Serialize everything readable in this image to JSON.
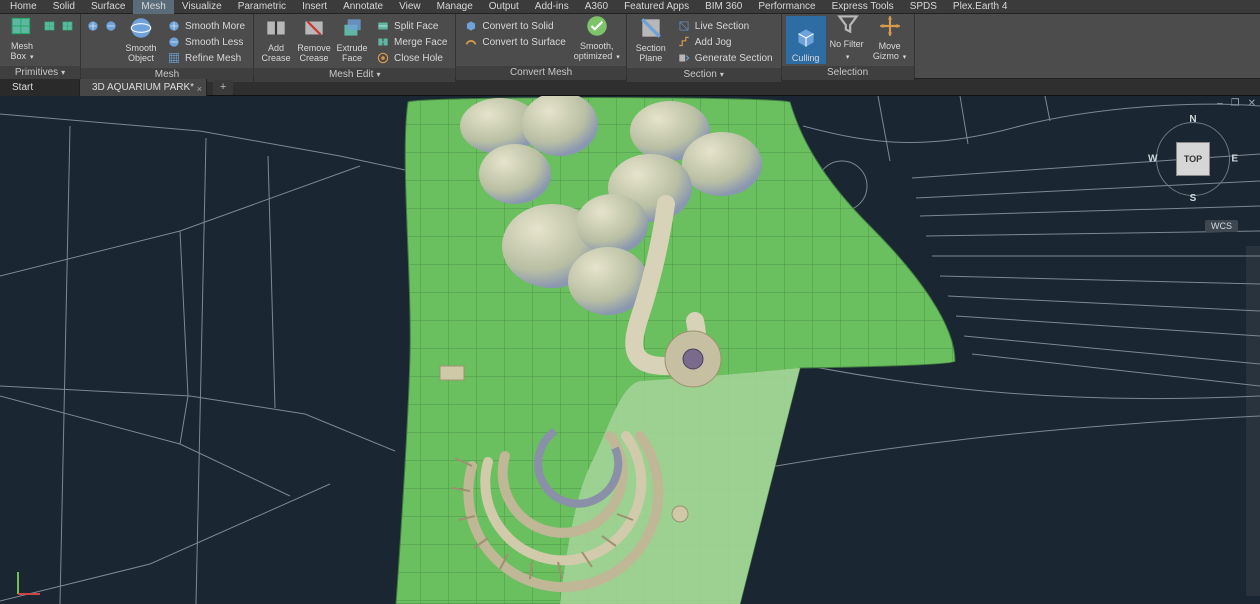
{
  "menu": {
    "items": [
      "Home",
      "Solid",
      "Surface",
      "Mesh",
      "Visualize",
      "Parametric",
      "Insert",
      "Annotate",
      "View",
      "Manage",
      "Output",
      "Add-ins",
      "A360",
      "Featured Apps",
      "BIM 360",
      "Performance",
      "Express Tools",
      "SPDS",
      "Plex.Earth 4"
    ],
    "activeIndex": 3
  },
  "ribbon": {
    "panels": [
      {
        "title": "Primitives",
        "hasChevron": true,
        "big": [
          {
            "label": "Mesh Box",
            "icon": "mesh-box",
            "hasChevron": true
          }
        ],
        "rows": []
      },
      {
        "title": "Mesh",
        "hasChevron": false,
        "miniIcons": [
          "smooth-more-mini",
          "smooth-less-mini"
        ],
        "big": [
          {
            "label": "Smooth\nObject",
            "icon": "smooth-object"
          }
        ],
        "rows": [
          {
            "icon": "smooth-more",
            "label": "Smooth More"
          },
          {
            "icon": "smooth-less",
            "label": "Smooth Less"
          },
          {
            "icon": "refine-mesh",
            "label": "Refine Mesh"
          }
        ]
      },
      {
        "title": "Mesh Edit",
        "hasChevron": true,
        "big": [
          {
            "label": "Add\nCrease",
            "icon": "add-crease"
          },
          {
            "label": "Remove\nCrease",
            "icon": "remove-crease"
          },
          {
            "label": "Extrude\nFace",
            "icon": "extrude-face"
          }
        ],
        "rows": [
          {
            "icon": "split-face",
            "label": "Split Face"
          },
          {
            "icon": "merge-face",
            "label": "Merge Face"
          },
          {
            "icon": "close-hole",
            "label": "Close Hole"
          }
        ]
      },
      {
        "title": "Convert Mesh",
        "hasChevron": false,
        "rows": [
          {
            "icon": "convert-solid",
            "label": "Convert to Solid"
          },
          {
            "icon": "convert-surface",
            "label": "Convert to Surface"
          }
        ],
        "big": [
          {
            "label": "Smooth,\noptimized",
            "icon": "smooth-opt",
            "hasChevron": true
          }
        ]
      },
      {
        "title": "Section",
        "hasChevron": true,
        "big": [
          {
            "label": "Section\nPlane",
            "icon": "section-plane"
          }
        ],
        "rows": [
          {
            "icon": "live-section",
            "label": "Live Section"
          },
          {
            "icon": "add-jog",
            "label": "Add Jog"
          },
          {
            "icon": "generate-section",
            "label": "Generate Section"
          }
        ]
      },
      {
        "title": "Selection",
        "hasChevron": false,
        "big": [
          {
            "label": "Culling",
            "icon": "culling",
            "active": true
          },
          {
            "label": "No Filter",
            "icon": "no-filter",
            "hasChevron": true
          },
          {
            "label": "Move\nGizmo",
            "icon": "move-gizmo",
            "hasChevron": true
          }
        ],
        "rows": []
      }
    ]
  },
  "tabs": {
    "start": "Start",
    "active": "3D AQUARIUM PARK*"
  },
  "viewcube": {
    "n": "N",
    "s": "S",
    "e": "E",
    "w": "W",
    "face": "TOP",
    "wcs": "WCS"
  },
  "winControls": {
    "min": "–",
    "max": "❐",
    "close": "✕"
  }
}
